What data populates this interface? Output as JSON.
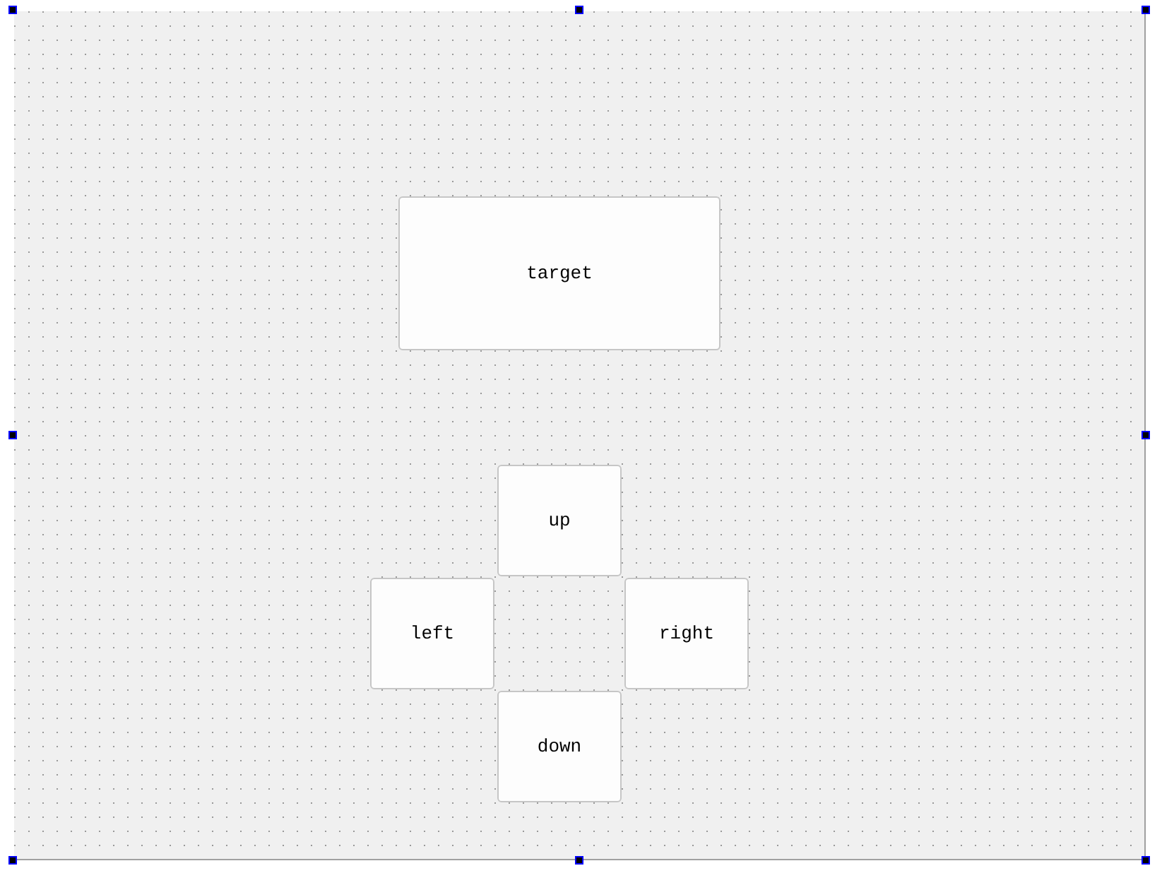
{
  "form": {
    "selected": true,
    "buttons": [
      {
        "label": "target"
      },
      {
        "label": "up"
      },
      {
        "label": "left"
      },
      {
        "label": "right"
      },
      {
        "label": "down"
      }
    ]
  }
}
